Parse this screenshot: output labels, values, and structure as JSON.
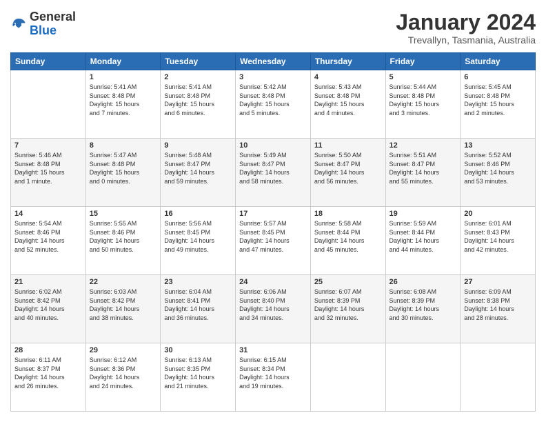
{
  "header": {
    "logo_general": "General",
    "logo_blue": "Blue",
    "main_title": "January 2024",
    "subtitle": "Trevallyn, Tasmania, Australia"
  },
  "calendar": {
    "days_of_week": [
      "Sunday",
      "Monday",
      "Tuesday",
      "Wednesday",
      "Thursday",
      "Friday",
      "Saturday"
    ],
    "weeks": [
      [
        {
          "day": "",
          "info": ""
        },
        {
          "day": "1",
          "info": "Sunrise: 5:41 AM\nSunset: 8:48 PM\nDaylight: 15 hours\nand 7 minutes."
        },
        {
          "day": "2",
          "info": "Sunrise: 5:41 AM\nSunset: 8:48 PM\nDaylight: 15 hours\nand 6 minutes."
        },
        {
          "day": "3",
          "info": "Sunrise: 5:42 AM\nSunset: 8:48 PM\nDaylight: 15 hours\nand 5 minutes."
        },
        {
          "day": "4",
          "info": "Sunrise: 5:43 AM\nSunset: 8:48 PM\nDaylight: 15 hours\nand 4 minutes."
        },
        {
          "day": "5",
          "info": "Sunrise: 5:44 AM\nSunset: 8:48 PM\nDaylight: 15 hours\nand 3 minutes."
        },
        {
          "day": "6",
          "info": "Sunrise: 5:45 AM\nSunset: 8:48 PM\nDaylight: 15 hours\nand 2 minutes."
        }
      ],
      [
        {
          "day": "7",
          "info": "Sunrise: 5:46 AM\nSunset: 8:48 PM\nDaylight: 15 hours\nand 1 minute."
        },
        {
          "day": "8",
          "info": "Sunrise: 5:47 AM\nSunset: 8:48 PM\nDaylight: 15 hours\nand 0 minutes."
        },
        {
          "day": "9",
          "info": "Sunrise: 5:48 AM\nSunset: 8:47 PM\nDaylight: 14 hours\nand 59 minutes."
        },
        {
          "day": "10",
          "info": "Sunrise: 5:49 AM\nSunset: 8:47 PM\nDaylight: 14 hours\nand 58 minutes."
        },
        {
          "day": "11",
          "info": "Sunrise: 5:50 AM\nSunset: 8:47 PM\nDaylight: 14 hours\nand 56 minutes."
        },
        {
          "day": "12",
          "info": "Sunrise: 5:51 AM\nSunset: 8:47 PM\nDaylight: 14 hours\nand 55 minutes."
        },
        {
          "day": "13",
          "info": "Sunrise: 5:52 AM\nSunset: 8:46 PM\nDaylight: 14 hours\nand 53 minutes."
        }
      ],
      [
        {
          "day": "14",
          "info": "Sunrise: 5:54 AM\nSunset: 8:46 PM\nDaylight: 14 hours\nand 52 minutes."
        },
        {
          "day": "15",
          "info": "Sunrise: 5:55 AM\nSunset: 8:46 PM\nDaylight: 14 hours\nand 50 minutes."
        },
        {
          "day": "16",
          "info": "Sunrise: 5:56 AM\nSunset: 8:45 PM\nDaylight: 14 hours\nand 49 minutes."
        },
        {
          "day": "17",
          "info": "Sunrise: 5:57 AM\nSunset: 8:45 PM\nDaylight: 14 hours\nand 47 minutes."
        },
        {
          "day": "18",
          "info": "Sunrise: 5:58 AM\nSunset: 8:44 PM\nDaylight: 14 hours\nand 45 minutes."
        },
        {
          "day": "19",
          "info": "Sunrise: 5:59 AM\nSunset: 8:44 PM\nDaylight: 14 hours\nand 44 minutes."
        },
        {
          "day": "20",
          "info": "Sunrise: 6:01 AM\nSunset: 8:43 PM\nDaylight: 14 hours\nand 42 minutes."
        }
      ],
      [
        {
          "day": "21",
          "info": "Sunrise: 6:02 AM\nSunset: 8:42 PM\nDaylight: 14 hours\nand 40 minutes."
        },
        {
          "day": "22",
          "info": "Sunrise: 6:03 AM\nSunset: 8:42 PM\nDaylight: 14 hours\nand 38 minutes."
        },
        {
          "day": "23",
          "info": "Sunrise: 6:04 AM\nSunset: 8:41 PM\nDaylight: 14 hours\nand 36 minutes."
        },
        {
          "day": "24",
          "info": "Sunrise: 6:06 AM\nSunset: 8:40 PM\nDaylight: 14 hours\nand 34 minutes."
        },
        {
          "day": "25",
          "info": "Sunrise: 6:07 AM\nSunset: 8:39 PM\nDaylight: 14 hours\nand 32 minutes."
        },
        {
          "day": "26",
          "info": "Sunrise: 6:08 AM\nSunset: 8:39 PM\nDaylight: 14 hours\nand 30 minutes."
        },
        {
          "day": "27",
          "info": "Sunrise: 6:09 AM\nSunset: 8:38 PM\nDaylight: 14 hours\nand 28 minutes."
        }
      ],
      [
        {
          "day": "28",
          "info": "Sunrise: 6:11 AM\nSunset: 8:37 PM\nDaylight: 14 hours\nand 26 minutes."
        },
        {
          "day": "29",
          "info": "Sunrise: 6:12 AM\nSunset: 8:36 PM\nDaylight: 14 hours\nand 24 minutes."
        },
        {
          "day": "30",
          "info": "Sunrise: 6:13 AM\nSunset: 8:35 PM\nDaylight: 14 hours\nand 21 minutes."
        },
        {
          "day": "31",
          "info": "Sunrise: 6:15 AM\nSunset: 8:34 PM\nDaylight: 14 hours\nand 19 minutes."
        },
        {
          "day": "",
          "info": ""
        },
        {
          "day": "",
          "info": ""
        },
        {
          "day": "",
          "info": ""
        }
      ]
    ]
  }
}
